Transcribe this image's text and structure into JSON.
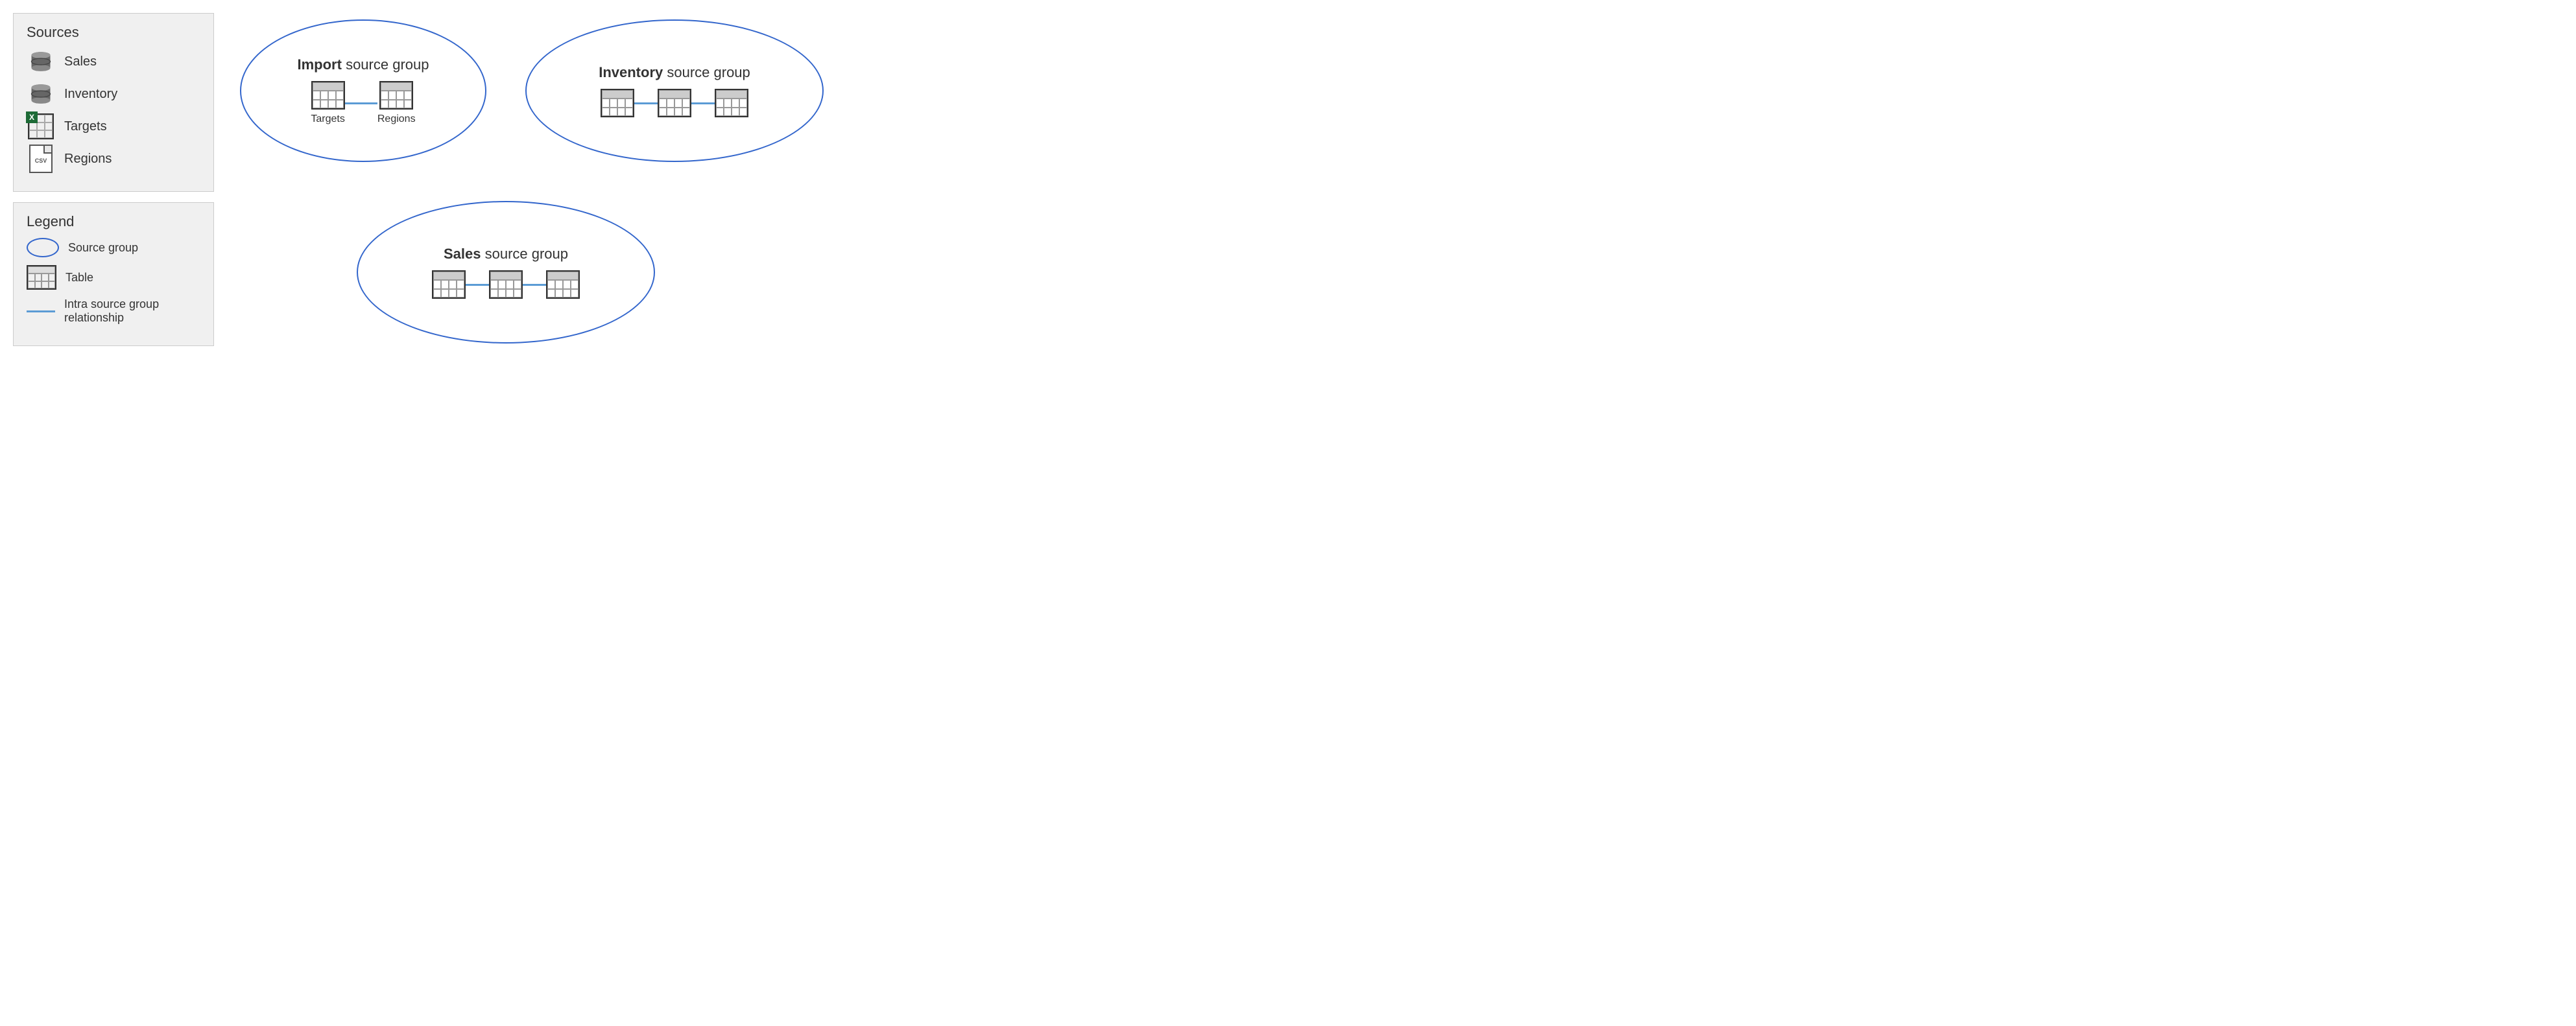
{
  "left": {
    "sources_title": "Sources",
    "sources": [
      {
        "name": "Sales",
        "icon": "database"
      },
      {
        "name": "Inventory",
        "icon": "database"
      },
      {
        "name": "Targets",
        "icon": "excel"
      },
      {
        "name": "Regions",
        "icon": "csv"
      }
    ],
    "legend_title": "Legend",
    "legend": [
      {
        "type": "ellipse",
        "label": "Source group"
      },
      {
        "type": "table",
        "label": "Table"
      },
      {
        "type": "line",
        "label": "Intra source group relationship"
      }
    ]
  },
  "diagram": {
    "groups": [
      {
        "id": "import",
        "title_bold": "Import",
        "title_rest": " source group",
        "tables": [
          {
            "label": "Targets"
          },
          {
            "label": "Regions"
          }
        ],
        "connectors": 1
      },
      {
        "id": "inventory",
        "title_bold": "Inventory",
        "title_rest": " source group",
        "tables": [
          {
            "label": ""
          },
          {
            "label": ""
          },
          {
            "label": ""
          }
        ],
        "connectors": 2
      },
      {
        "id": "sales",
        "title_bold": "Sales",
        "title_rest": " source group",
        "tables": [
          {
            "label": ""
          },
          {
            "label": ""
          },
          {
            "label": ""
          }
        ],
        "connectors": 2
      }
    ]
  }
}
